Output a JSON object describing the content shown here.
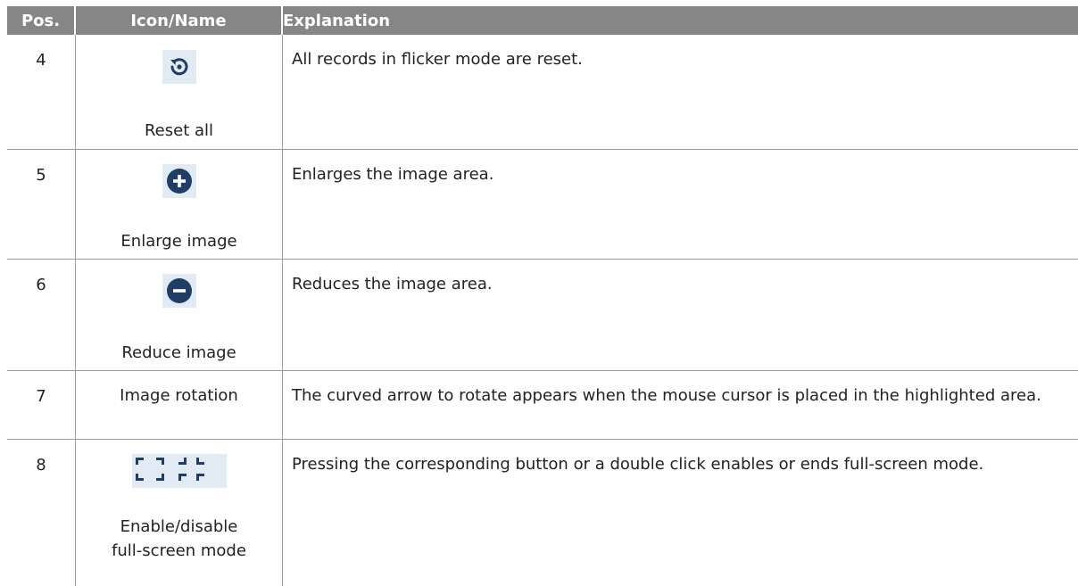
{
  "columns": {
    "pos": "Pos.",
    "icon_name": "Icon/Name",
    "explanation": "Explanation"
  },
  "rows": [
    {
      "pos": "4",
      "name": "Reset all",
      "icon": "reset-all-icon",
      "explanation": "All records in flicker mode are reset."
    },
    {
      "pos": "5",
      "name": "Enlarge image",
      "icon": "zoom-in-icon",
      "explanation": "Enlarges the image area."
    },
    {
      "pos": "6",
      "name": "Reduce image",
      "icon": "zoom-out-icon",
      "explanation": "Reduces the image area."
    },
    {
      "pos": "7",
      "name": "Image rotation",
      "icon": "",
      "explanation": "The curved arrow to rotate appears when the mouse cursor is placed in the highlighted area."
    },
    {
      "pos": "8",
      "name_line1": "Enable/disable",
      "name_line2": "full-screen mode",
      "icon": "fullscreen-toggle-icon",
      "explanation": "Pressing the corresponding button or a double click enables or ends full-screen mode."
    }
  ],
  "colors": {
    "header_bg": "#868686",
    "icon_bg": "#e2ebf4",
    "icon_fg": "#1f3d66"
  }
}
